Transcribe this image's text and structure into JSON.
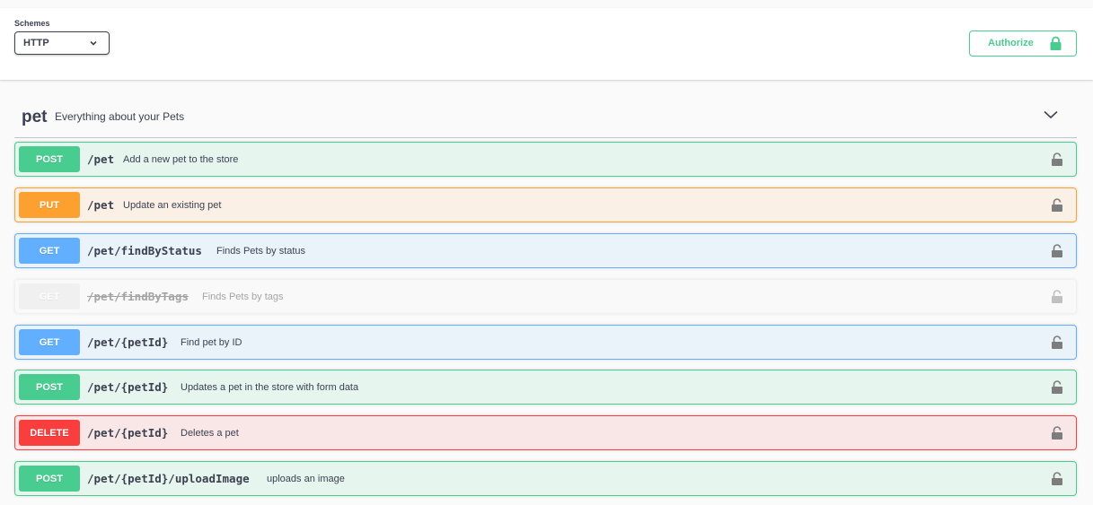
{
  "schemes": {
    "label": "Schemes",
    "selected": "HTTP"
  },
  "authorize": {
    "label": "Authorize"
  },
  "tag": {
    "name": "pet",
    "description": "Everything about your Pets"
  },
  "operations": [
    {
      "method": "POST",
      "path": "/pet",
      "summary": "Add a new pet to the store"
    },
    {
      "method": "PUT",
      "path": "/pet",
      "summary": "Update an existing pet"
    },
    {
      "method": "GET",
      "path": "/pet/findByStatus",
      "summary": "Finds Pets by status"
    },
    {
      "method": "GET",
      "path": "/pet/findByTags",
      "summary": "Finds Pets by tags"
    },
    {
      "method": "GET",
      "path": "/pet/{petId}",
      "summary": "Find pet by ID"
    },
    {
      "method": "POST",
      "path": "/pet/{petId}",
      "summary": "Updates a pet in the store with form data"
    },
    {
      "method": "DELETE",
      "path": "/pet/{petId}",
      "summary": "Deletes a pet"
    },
    {
      "method": "POST",
      "path": "/pet/{petId}/uploadImage",
      "summary": "uploads an image"
    }
  ],
  "colors": {
    "post": "#49cc90",
    "put": "#fca130",
    "get": "#61affe",
    "delete": "#f93e3e",
    "deprecated": "#ebebeb"
  }
}
